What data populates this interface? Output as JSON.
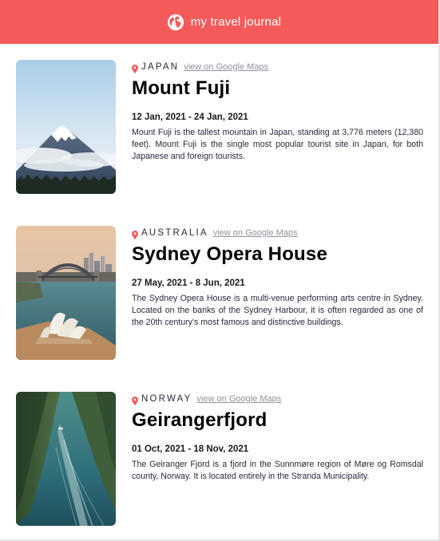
{
  "header": {
    "title": "my travel journal",
    "icon": "globe-icon",
    "background": "#f55a5a"
  },
  "entries": [
    {
      "country": "JAPAN",
      "maps_link": "view on Google Maps",
      "title": "Mount Fuji",
      "dates": "12 Jan, 2021 - 24 Jan, 2021",
      "description": "Mount Fuji is the tallest mountain in Japan, standing at 3,776 meters (12,380 feet). Mount Fuji is the single most popular tourist site in Japan, for both Japanese and foreign tourists.",
      "image": "mount-fuji-photo"
    },
    {
      "country": "AUSTRALIA",
      "maps_link": "view on Google Maps",
      "title": "Sydney Opera House",
      "dates": "27 May, 2021 - 8 Jun, 2021",
      "description": "The Sydney Opera House is a multi-venue performing arts centre in Sydney. Located on the banks of the Sydney Harbour, it is often regarded as one of the 20th century's most famous and distinctive buildings.",
      "image": "sydney-opera-house-photo"
    },
    {
      "country": "NORWAY",
      "maps_link": "view on Google Maps",
      "title": "Geirangerfjord",
      "dates": "01 Oct, 2021 - 18 Nov, 2021",
      "description": "The Geiranger Fjord is a fjord in the Sunnmøre region of Møre og Romsdal county, Norway. It is located entirely in the Stranda Municipality.",
      "image": "geirangerfjord-photo"
    }
  ],
  "colors": {
    "accent": "#f55a5a",
    "link": "#918e9b",
    "text": "#2b283a"
  }
}
